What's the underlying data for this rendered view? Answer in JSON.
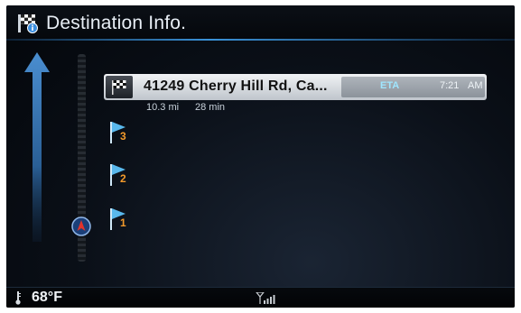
{
  "header": {
    "title": "Destination Info."
  },
  "destination": {
    "address": "41249 Cherry Hill Rd, Ca...",
    "eta_label": "ETA",
    "eta_time": "7:21",
    "eta_ampm": "AM",
    "distance": "10.3 mi",
    "duration": "28 min"
  },
  "waypoints": [
    {
      "label": "3"
    },
    {
      "label": "2"
    },
    {
      "label": "1"
    }
  ],
  "footer": {
    "temperature": "68°F"
  },
  "colors": {
    "accent": "#3a92d8",
    "eta_text": "#9fe6ff",
    "waypoint_number": "#f39a2b"
  }
}
